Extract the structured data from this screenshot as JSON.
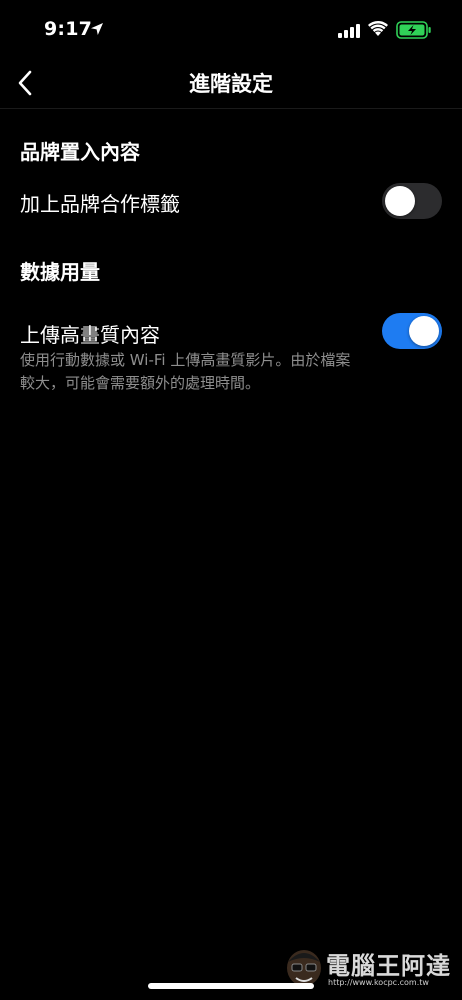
{
  "status_bar": {
    "time": "9:17",
    "icons": [
      "location-arrow-icon",
      "cellular-signal-icon",
      "wifi-icon",
      "battery-charging-icon"
    ],
    "battery_color": "#30d158"
  },
  "nav": {
    "back_icon": "chevron-left-icon",
    "title": "進階設定"
  },
  "sections": [
    {
      "header": "品牌置入內容",
      "rows": [
        {
          "label": "加上品牌合作標籤",
          "toggle": false
        }
      ]
    },
    {
      "header": "數據用量",
      "rows": [
        {
          "label": "上傳高畫質內容",
          "description": "使用行動數據或 Wi-Fi 上傳高畫質影片。由於檔案較大，可能會需要額外的處理時間。",
          "toggle": true
        }
      ]
    }
  ],
  "colors": {
    "background": "#000000",
    "toggle_on": "#1e7cf2",
    "toggle_off": "#2c2c2e",
    "secondary_text": "#8e8e8e"
  },
  "watermark": {
    "title": "電腦王阿達",
    "url": "http://www.kocpc.com.tw"
  }
}
